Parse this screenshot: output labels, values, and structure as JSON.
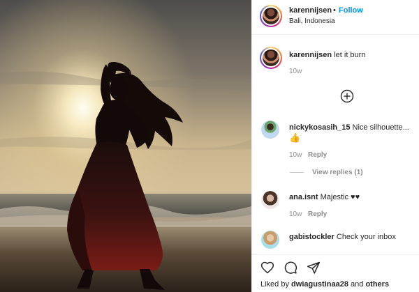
{
  "post": {
    "username": "karennijsen",
    "follow_label": "Follow",
    "separator": "•",
    "location": "Bali, Indonesia"
  },
  "caption": {
    "username": "karennijsen",
    "text": "let it burn",
    "time": "10w"
  },
  "load_more_icon": "plus-circle-icon",
  "comments": [
    {
      "username": "nickykosasih_15",
      "text": "Nice silhouette...",
      "emoji": "👍",
      "time": "10w",
      "reply_label": "Reply",
      "view_replies": "View replies (1)"
    },
    {
      "username": "ana.isnt",
      "text": "Majestic ♥♥",
      "time": "10w",
      "reply_label": "Reply"
    },
    {
      "username": "gabistockler",
      "text": "Check your inbox"
    }
  ],
  "actions": {
    "icons": [
      "heart-icon",
      "comment-icon",
      "share-icon"
    ]
  },
  "likes": {
    "prefix": "Liked by",
    "user": "dwiagustinaa28",
    "conjunction": "and",
    "others": "others"
  },
  "colors": {
    "link_blue": "#0095f6",
    "text": "#262626",
    "muted": "#8e8e8e",
    "border": "#efefef"
  }
}
